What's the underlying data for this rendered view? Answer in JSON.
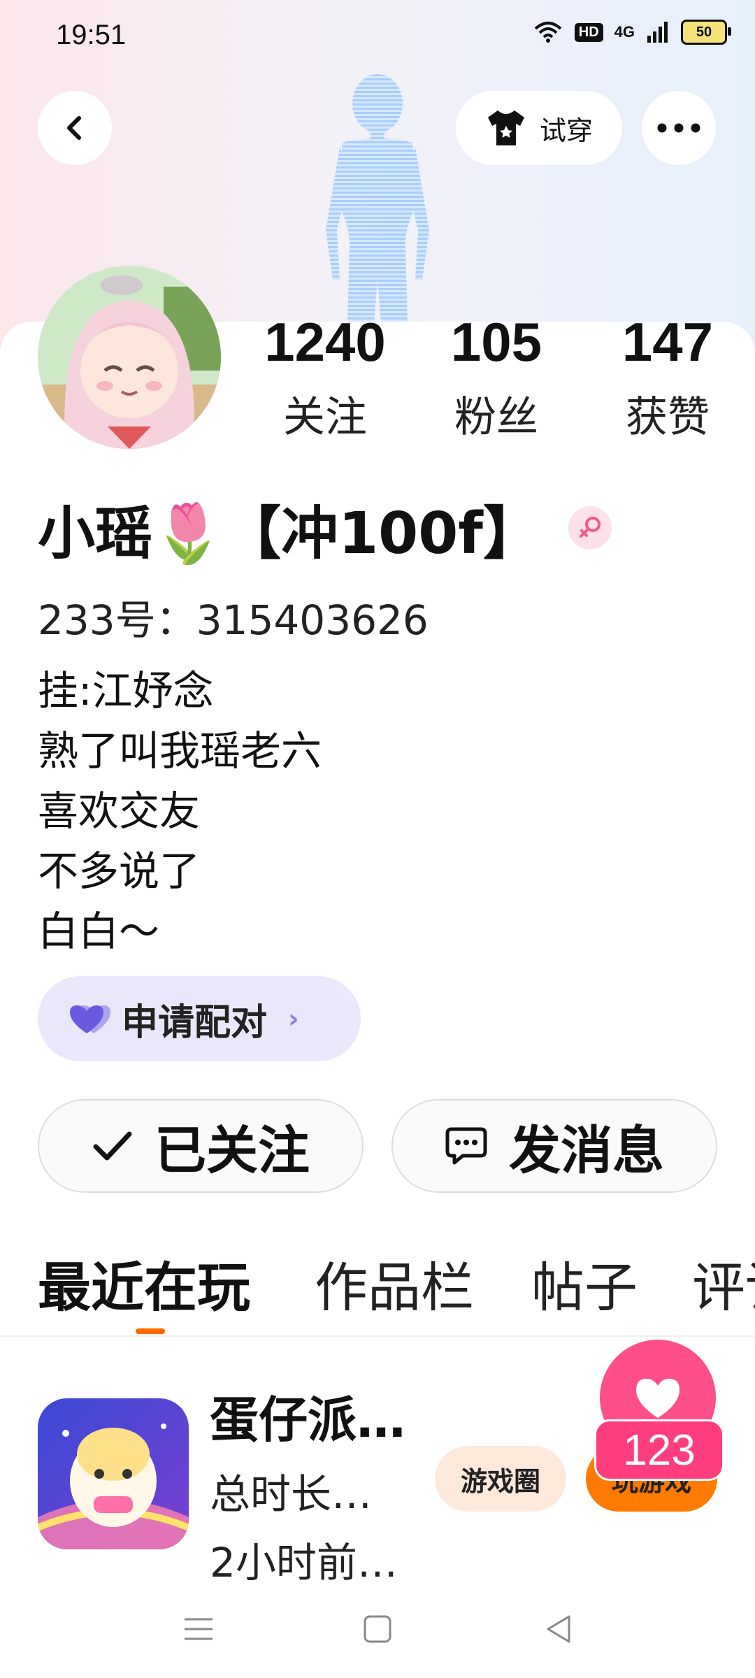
{
  "status_bar": {
    "time": "19:51",
    "hd": "HD",
    "network": "4G",
    "battery": "50"
  },
  "header": {
    "try_on_label": "试穿"
  },
  "stats": [
    {
      "value": "1240",
      "label": "关注"
    },
    {
      "value": "105",
      "label": "粉丝"
    },
    {
      "value": "147",
      "label": "获赞"
    }
  ],
  "profile": {
    "name": "小瑶🌷【冲100f】",
    "uid": "233号：315403626",
    "bio": [
      "挂:江妤念",
      "熟了叫我瑶老六",
      "喜欢交友",
      "不多说了",
      "白白～"
    ]
  },
  "pair_button": {
    "label": "申请配对"
  },
  "actions": {
    "follow_label": "已关注",
    "message_label": "发消息"
  },
  "tabs": [
    {
      "label": "最近在玩",
      "active": true
    },
    {
      "label": "作品栏",
      "active": false
    },
    {
      "label": "帖子",
      "active": false
    },
    {
      "label": "评论",
      "active": false
    }
  ],
  "game": {
    "title": "蛋仔派…",
    "duration": "总时长…",
    "last_played": "2小时前…",
    "circle_label": "游戏圈",
    "play_label": "玩游戏"
  },
  "floating_like": {
    "count": "123"
  },
  "colors": {
    "accent": "#ff6a00",
    "like": "#ff4f8b",
    "pair_bg": "#ebe7fb"
  }
}
